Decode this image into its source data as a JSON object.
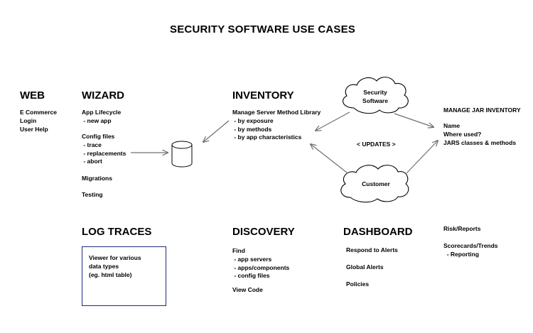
{
  "title": "SECURITY SOFTWARE USE CASES",
  "web": {
    "heading": "WEB",
    "items": [
      "E Commerce",
      "Login",
      "User Help"
    ]
  },
  "wizard": {
    "heading": "WIZARD",
    "app_lifecycle": "App Lifecycle",
    "new_app": " - new app",
    "config_files": "Config files",
    "config_items": [
      " - trace",
      " - replacements",
      " - abort"
    ],
    "migrations": "Migrations",
    "testing": "Testing"
  },
  "inventory": {
    "heading": "INVENTORY",
    "manage": "Manage Server Method Library",
    "items": [
      " - by exposure",
      " - by methods",
      " - by app characteristics"
    ]
  },
  "security_cloud": {
    "line1": "Security",
    "line2": "Software"
  },
  "customer_cloud": {
    "label": "Customer"
  },
  "updates_label": "< UPDATES >",
  "jar": {
    "heading": "MANAGE JAR INVENTORY",
    "items": [
      "Name",
      "Where used?",
      "JARS classes & methods"
    ]
  },
  "log_traces": {
    "heading": "LOG TRACES",
    "box_lines": [
      "Viewer for various",
      "data types",
      "(eg. html table)"
    ]
  },
  "discovery": {
    "heading": "DISCOVERY",
    "find": "Find",
    "items": [
      " - app servers",
      " - apps/components",
      " - config files"
    ],
    "view_code": "View Code"
  },
  "dashboard": {
    "heading": "DASHBOARD",
    "items": [
      "Respond to Alerts",
      "Global Alerts",
      "Policies"
    ]
  },
  "risk": {
    "risk_reports": "Risk/Reports",
    "scorecards": "Scorecards/Trends",
    "reporting": "  - Reporting"
  },
  "colors": {
    "box_border": "#1f2a7a",
    "arrow": "#707070"
  }
}
